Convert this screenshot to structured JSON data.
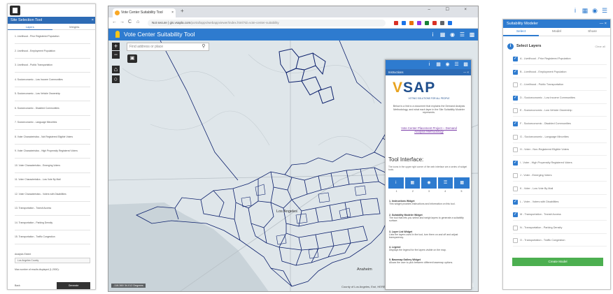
{
  "left_panel": {
    "title": "Site Selection Tool",
    "close": "×",
    "tabs": [
      "Layers",
      "Weights"
    ],
    "rows": [
      "1. Livelihood - Prior Registered Population",
      "2. Livelihood - Employment Population",
      "3. Livelihood - Public Transportation",
      "4. Socioeconomic - Low Income Communities",
      "5. Socioeconomic - Low Vehicle Ownership",
      "6. Socioeconomic - Disabled Communities",
      "7. Socioeconomic - Language Minorities",
      "8. Voter Characteristics - Not Registered Eligible Voters",
      "9. Voter Characteristics - High Propensity Registered Voters",
      "10. Voter Characteristics - Emerging Voters",
      "11. Voter Characteristics - Low Vote By Mail",
      "12. Voter Characteristics - Voters with Disabilities",
      "13. Transportation - Transit Access",
      "14. Transportation - Parking Density",
      "15. Transportation - Traffic Congestion"
    ],
    "field_label": "Analysis Extent",
    "field_value": "Los Angeles County",
    "footer_text": "Max number of results displayed (1-2000):",
    "back": "Back",
    "submit": "Generate"
  },
  "browser": {
    "tab_title": "Vote Center Suitability Tool",
    "tab_close": "×",
    "new_tab": "+",
    "window_controls": "– ☐ ×",
    "nav": [
      "←",
      "→",
      "C",
      "⌂"
    ],
    "url_prefix": "Not secure",
    "url_host": "gis.vsapla.com",
    "url_rest": "/portal/apps/webappviewer/index.html?id=vote-center-suitability",
    "ext_colors": [
      "#d93025",
      "#1a73e8",
      "#e8710a",
      "#9334e6",
      "#188038",
      "#d93025",
      "#5f6368",
      "#1a73e8"
    ]
  },
  "app": {
    "title": "Vote Center Suitability Tool",
    "header_icons": [
      "info-icon",
      "layers-grid-icon",
      "basemap-icon",
      "list-icon",
      "apps-icon"
    ],
    "header_glyphs": [
      "i",
      "▦",
      "◉",
      "☰",
      "▩"
    ]
  },
  "map": {
    "search_placeholder": "Find address or place",
    "search_icon": "⚲",
    "zoom_in": "+",
    "zoom_out": "−",
    "home": "⌂",
    "locate": "○",
    "layers": "▣",
    "scale": "-118.360 34.012 Degrees",
    "attribution": "County of Los Angeles, Esri, HERE, Garmin, FAO, METI/NASA, USGS, Bureau of Land Ma...",
    "esri": "esri",
    "labels": {
      "los_angeles": "Los Angeles",
      "anaheim": "Anaheim"
    },
    "colors": {
      "land": "#dfe6ea",
      "water": "#c9d3d9",
      "boundary": "#0b1f6b"
    }
  },
  "popup": {
    "header_glyphs": [
      "i",
      "▦",
      "◉",
      "☰",
      "▩"
    ],
    "title": "Instructions",
    "controls": "— ×",
    "logo_v": "V",
    "logo_rest": "SAP",
    "tagline": "VOTING SOLUTIONS FOR ALL PEOPLE",
    "body": "Below is a link to a document that explains the Demand Analysis Methodology, and what each layer in the Site Suitability Modeler represents.",
    "link": "Vote Center Placement Project – Demand Analysis Methodology",
    "tool_title": "Tool Interface:",
    "tool_desc": "The icons in the upper right corner of the web interface are a series of widget tools.",
    "icons": [
      "i",
      "▦",
      "◉",
      "☰",
      "▩"
    ],
    "icon_numbers": [
      "1",
      "2",
      "3",
      "4",
      "5"
    ],
    "steps": [
      {
        "head": "1. Instructions Widget",
        "text": "This widget provides instructions and information on this tool."
      },
      {
        "head": "2. Suitability Modeler Widget",
        "text": "The tool that lets you select and weigh layers to generate a suitability surface."
      },
      {
        "head": "3. Layer List Widget",
        "text": "Lists the layers used in the tool, turn them on and off and adjust transparency."
      },
      {
        "head": "4. Legend",
        "text": "Displays the legend for the layers visible on the map."
      },
      {
        "head": "5. Basemap Gallery Widget",
        "text": "Allows the user to pick between different basemap options."
      }
    ]
  },
  "right_panel": {
    "top_glyphs": [
      "i",
      "▦",
      "◉",
      "☰",
      "▩"
    ],
    "title": "Suitability Modeler",
    "controls": "— ×",
    "tabs": [
      "Select",
      "Model",
      "Share"
    ],
    "section_title": "Select Layers",
    "section_aux": "Clear all",
    "items": [
      {
        "label": "A - Livelihood - Prior Registered Population",
        "checked": true
      },
      {
        "label": "B - Livelihood - Employment Population",
        "checked": true
      },
      {
        "label": "C - Livelihood - Public Transportation",
        "checked": false
      },
      {
        "label": "D - Socioeconomic - Low Income Communities",
        "checked": true
      },
      {
        "label": "E - Socioeconomic - Low Vehicle Ownership",
        "checked": false
      },
      {
        "label": "F - Socioeconomic - Disabled Communities",
        "checked": true
      },
      {
        "label": "G - Socioeconomic - Language Minorities",
        "checked": false
      },
      {
        "label": "H - Voter - Non-Registered Eligible Voters",
        "checked": false
      },
      {
        "label": "I - Voter - High Propensity Registered Voters",
        "checked": true
      },
      {
        "label": "J - Voter - Emerging Voters",
        "checked": false
      },
      {
        "label": "K - Voter - Low Vote By Mail",
        "checked": false
      },
      {
        "label": "L - Voter - Voters with Disabilities",
        "checked": true
      },
      {
        "label": "M - Transportation - Transit Access",
        "checked": true
      },
      {
        "label": "N - Transportation - Parking Density",
        "checked": false
      },
      {
        "label": "O - Transportation - Traffic Congestion",
        "checked": false
      }
    ],
    "button": "Create Model",
    "accent": "#2e7bcf",
    "button_color": "#4caf50"
  }
}
